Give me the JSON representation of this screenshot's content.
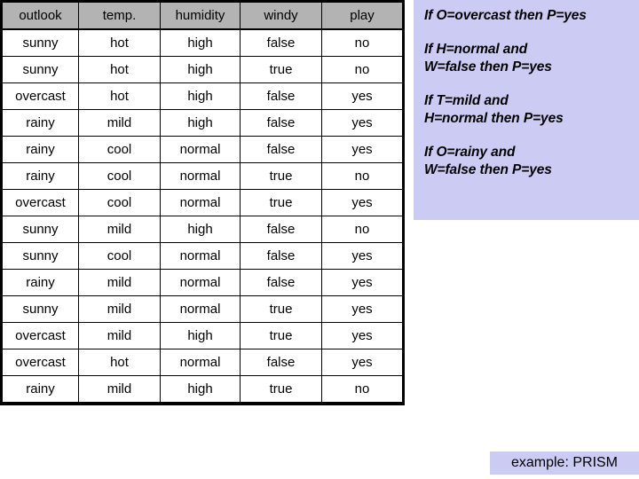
{
  "table": {
    "columns": [
      "outlook",
      "temp.",
      "humidity",
      "windy",
      "play"
    ],
    "rows": [
      [
        "sunny",
        "hot",
        "high",
        "false",
        "no"
      ],
      [
        "sunny",
        "hot",
        "high",
        "true",
        "no"
      ],
      [
        "overcast",
        "hot",
        "high",
        "false",
        "yes"
      ],
      [
        "rainy",
        "mild",
        "high",
        "false",
        "yes"
      ],
      [
        "rainy",
        "cool",
        "normal",
        "false",
        "yes"
      ],
      [
        "rainy",
        "cool",
        "normal",
        "true",
        "no"
      ],
      [
        "overcast",
        "cool",
        "normal",
        "true",
        "yes"
      ],
      [
        "sunny",
        "mild",
        "high",
        "false",
        "no"
      ],
      [
        "sunny",
        "cool",
        "normal",
        "false",
        "yes"
      ],
      [
        "rainy",
        "mild",
        "normal",
        "false",
        "yes"
      ],
      [
        "sunny",
        "mild",
        "normal",
        "true",
        "yes"
      ],
      [
        "overcast",
        "mild",
        "high",
        "true",
        "yes"
      ],
      [
        "overcast",
        "hot",
        "normal",
        "false",
        "yes"
      ],
      [
        "rainy",
        "mild",
        "high",
        "true",
        "no"
      ]
    ]
  },
  "rules_panel": {
    "background_color": "#cbcbf4",
    "rules": [
      {
        "lines": [
          "If O=overcast then P=yes"
        ]
      },
      {
        "lines": [
          "If H=normal and",
          "W=false then P=yes"
        ]
      },
      {
        "lines": [
          "If T=mild and",
          "H=normal then P=yes"
        ]
      },
      {
        "lines": [
          "If O=rainy and",
          "W=false then P=yes"
        ]
      }
    ]
  },
  "footer": {
    "caption": "example: PRISM",
    "background_color": "#cbcbf4"
  },
  "colors": {
    "header_gray": "#b3b3b3",
    "panel_lavender": "#cbcbf4",
    "page_background": "#ffffff",
    "text": "#000000"
  }
}
